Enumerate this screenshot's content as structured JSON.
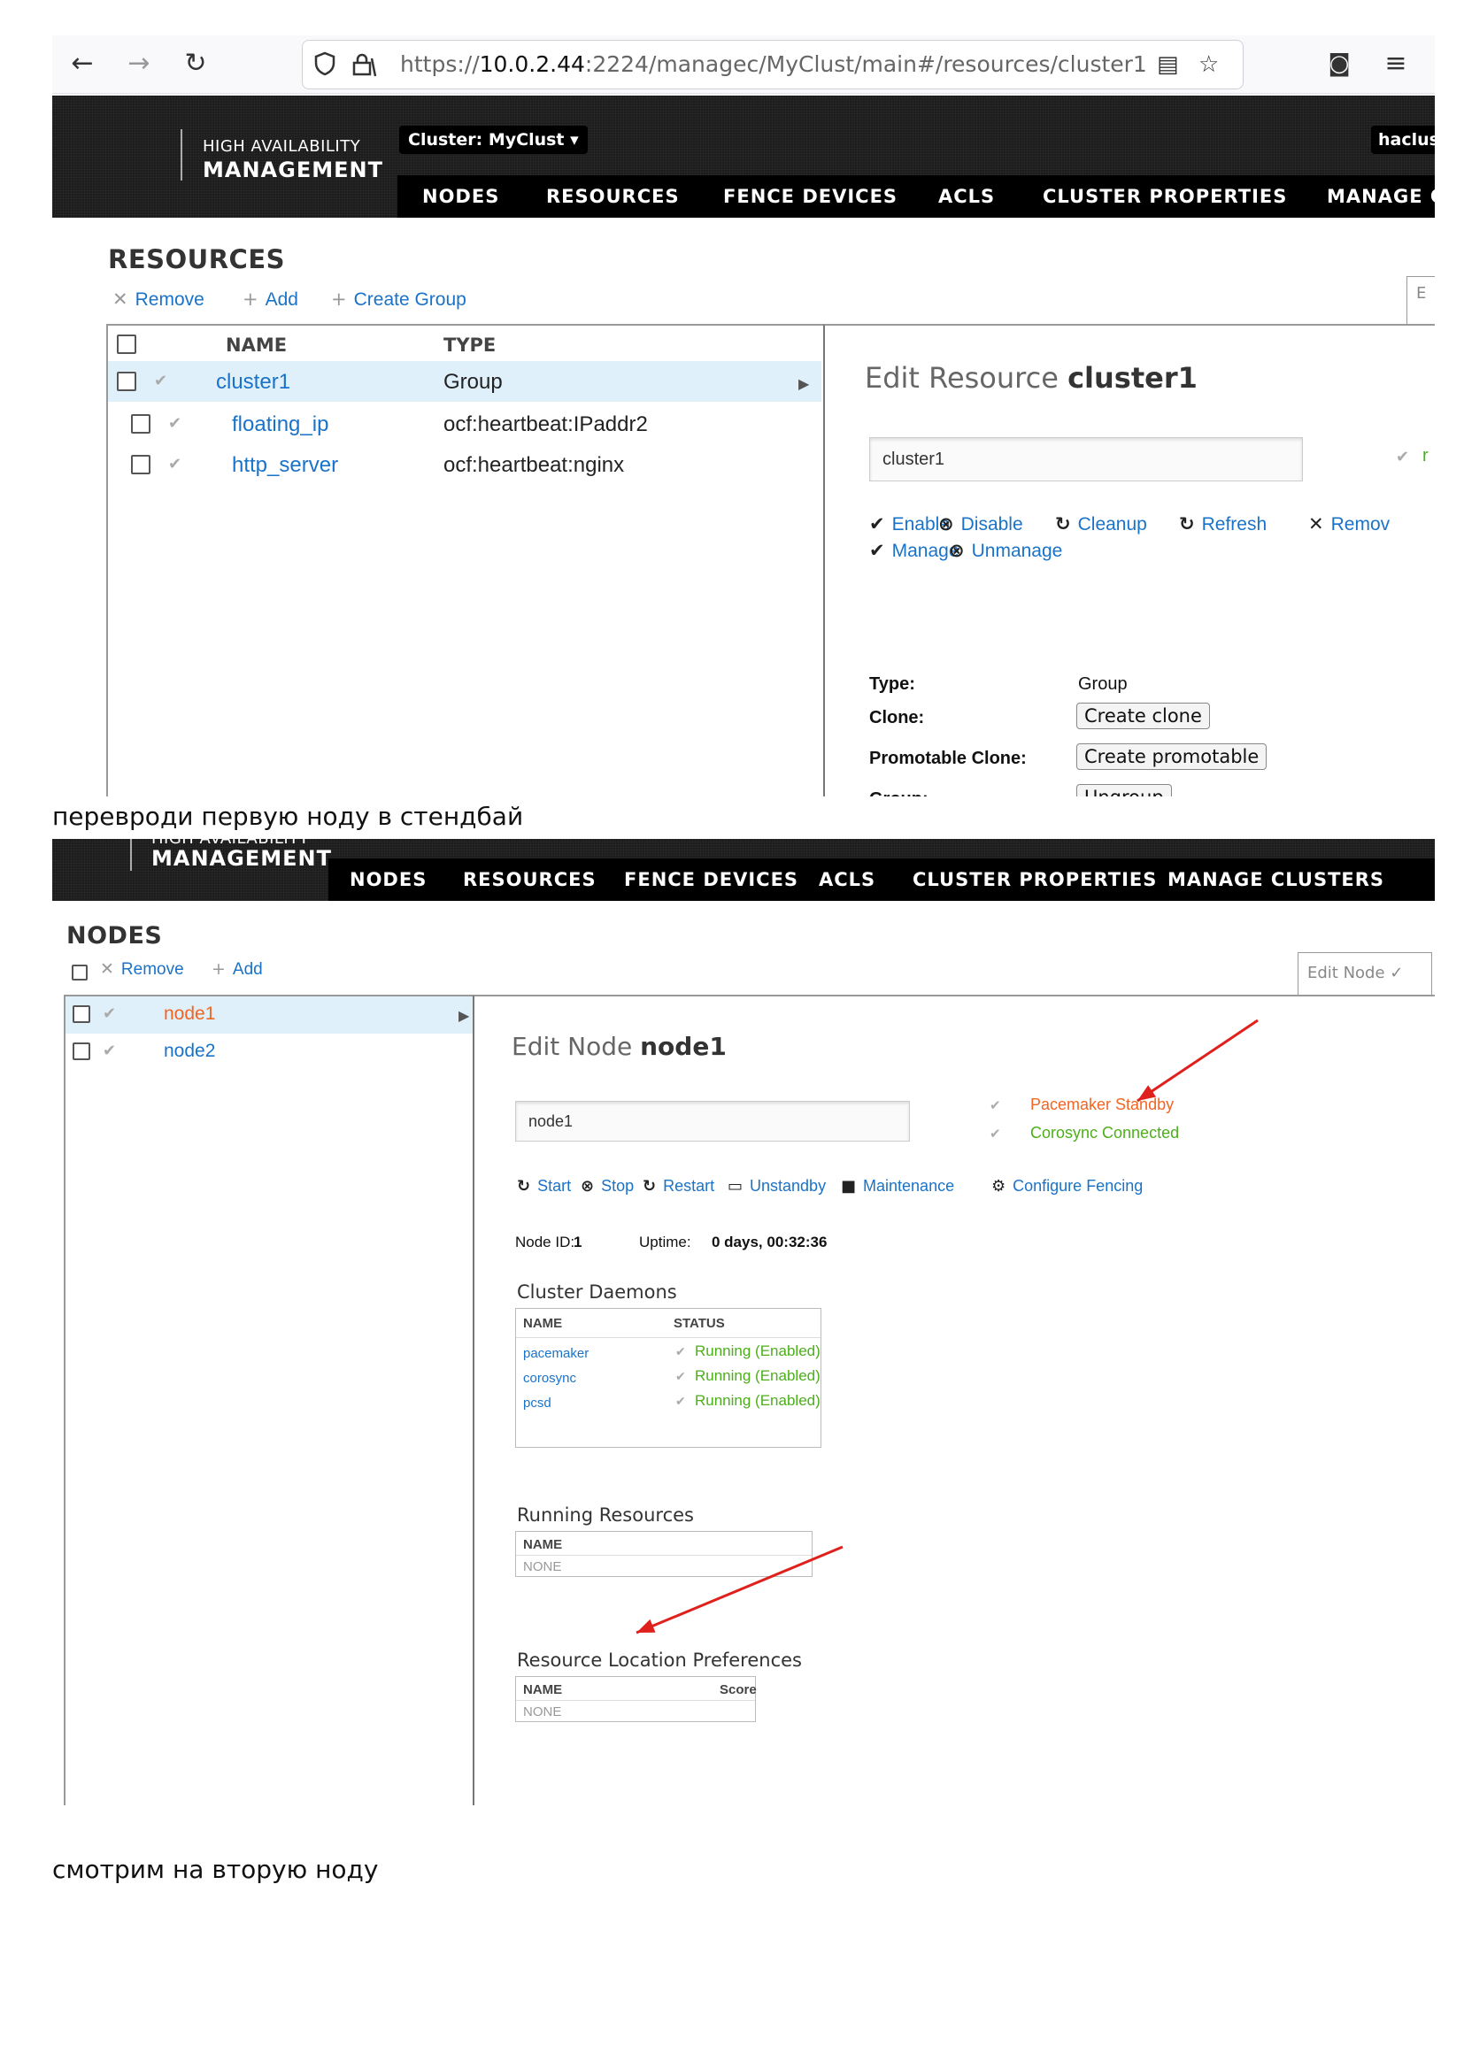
{
  "screenshot1": {
    "browser": {
      "back_icon": "←",
      "forward_icon": "→",
      "reload_icon": "↻",
      "url_prefix": "https://",
      "url_host": "10.0.2.44",
      "url_rest": ":2224/managec/MyClust/main#/resources/cluster1",
      "reader_icon": "▤",
      "star_icon": "☆",
      "pocket_icon": "◙",
      "menu_icon": "≡"
    },
    "header": {
      "logo_line1": "HIGH AVAILABILITY",
      "logo_line2": "MANAGEMENT",
      "cluster_selector": "Cluster: MyClust ▾",
      "user": "haclus",
      "tabs": [
        "NODES",
        "RESOURCES",
        "FENCE DEVICES",
        "ACLS",
        "CLUSTER PROPERTIES",
        "MANAGE C"
      ]
    },
    "title": "RESOURCES",
    "toolbar": {
      "remove": "Remove",
      "add": "Add",
      "create_group": "Create Group"
    },
    "edit_tab": "E",
    "table": {
      "col_name": "NAME",
      "col_type": "TYPE",
      "rows": [
        {
          "name": "cluster1",
          "type": "Group"
        },
        {
          "name": "floating_ip",
          "type": "ocf:heartbeat:IPaddr2"
        },
        {
          "name": "http_server",
          "type": "ocf:heartbeat:nginx"
        }
      ]
    },
    "edit": {
      "title_prefix": "Edit Resource",
      "title_name": "cluster1",
      "input_value": "cluster1",
      "status_fragment": "r",
      "actions": {
        "enable": "Enable",
        "disable": "Disable",
        "cleanup": "Cleanup",
        "refresh": "Refresh",
        "remove": "Remov",
        "manage": "Manage",
        "unmanage": "Unmanage"
      },
      "type_label": "Type:",
      "type_value": "Group",
      "clone_label": "Clone:",
      "clone_button": "Create clone",
      "promotable_label": "Promotable Clone:",
      "promotable_button": "Create promotable",
      "group_label": "Group:",
      "group_button": "Ungroup"
    }
  },
  "caption1": "переврoди первую ноду в стендбай",
  "screenshot2": {
    "header": {
      "logo_line1": "HIGH AVAILABILITY",
      "logo_line2": "MANAGEMENT",
      "tabs": [
        "NODES",
        "RESOURCES",
        "FENCE DEVICES",
        "ACLS",
        "CLUSTER PROPERTIES",
        "MANAGE CLUSTERS"
      ]
    },
    "title": "NODES",
    "toolbar": {
      "remove": "Remove",
      "add": "Add"
    },
    "edit_tab": "Edit Node ✓",
    "nodes": [
      {
        "name": "node1",
        "color": "#f26522"
      },
      {
        "name": "node2",
        "color": "#1a73c8"
      }
    ],
    "edit": {
      "title_prefix": "Edit Node",
      "title_name": "node1",
      "input_value": "node1",
      "status_pacemaker": "Pacemaker Standby",
      "status_corosync": "Corosync Connected",
      "actions": {
        "start": "Start",
        "stop": "Stop",
        "restart": "Restart",
        "unstandby": "Unstandby",
        "maintenance": "Maintenance",
        "configure_fencing": "Configure Fencing"
      },
      "node_id_label": "Node ID:",
      "node_id_value": "1",
      "uptime_label": "Uptime:",
      "uptime_value": "0 days, 00:32:36"
    },
    "daemons": {
      "title": "Cluster Daemons",
      "col_name": "NAME",
      "col_status": "STATUS",
      "rows": [
        {
          "name": "pacemaker",
          "status": "Running (Enabled)"
        },
        {
          "name": "corosync",
          "status": "Running (Enabled)"
        },
        {
          "name": "pcsd",
          "status": "Running (Enabled)"
        }
      ]
    },
    "running_resources": {
      "title": "Running Resources",
      "col_name": "NAME",
      "empty": "NONE"
    },
    "location_prefs": {
      "title": "Resource Location Preferences",
      "col_name": "NAME",
      "col_score": "Score",
      "empty": "NONE"
    },
    "annotation_color": "#e0201c"
  },
  "caption2": "смотрим на вторую ноду"
}
